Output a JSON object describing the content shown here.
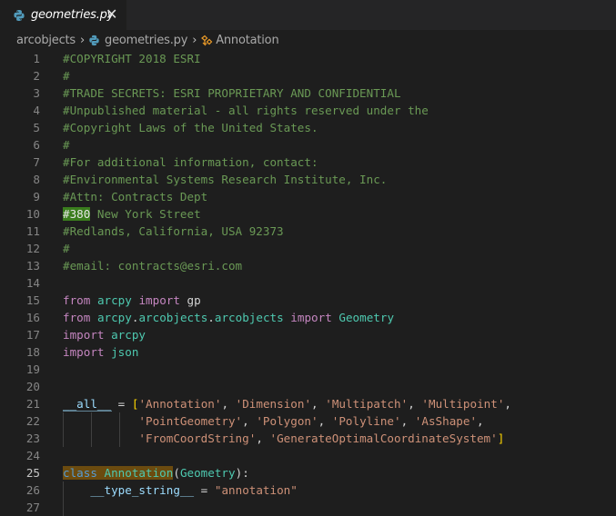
{
  "tab": {
    "filename": "geometries.py",
    "close_glyph": "✕"
  },
  "breadcrumb": {
    "folder": "arcobjects",
    "file": "geometries.py",
    "symbol": "Annotation",
    "separator": "›"
  },
  "colors": {
    "comment": "#6a9955",
    "keyword_import": "#c586c0",
    "keyword_class": "#569cd6",
    "module": "#4ec9b0",
    "identifier": "#9cdcfe",
    "string": "#ce9178",
    "default": "#d4d4d4",
    "class_name": "#4ec9b0",
    "bracket": "#ffd700"
  },
  "editor": {
    "active_line": 25,
    "lines": [
      {
        "n": "1",
        "code": "#COPYRIGHT 2018 ESRI"
      },
      {
        "n": "2",
        "code": "#"
      },
      {
        "n": "3",
        "code": "#TRADE SECRETS: ESRI PROPRIETARY AND CONFIDENTIAL"
      },
      {
        "n": "4",
        "code": "#Unpublished material - all rights reserved under the"
      },
      {
        "n": "5",
        "code": "#Copyright Laws of the United States."
      },
      {
        "n": "6",
        "code": "#"
      },
      {
        "n": "7",
        "code": "#For additional information, contact:"
      },
      {
        "n": "8",
        "code": "#Environmental Systems Research Institute, Inc."
      },
      {
        "n": "9",
        "code": "#Attn: Contracts Dept"
      },
      {
        "n": "10",
        "code": "#380 New York Street"
      },
      {
        "n": "11",
        "code": "#Redlands, California, USA 92373"
      },
      {
        "n": "12",
        "code": "#"
      },
      {
        "n": "13",
        "code": "#email: contracts@esri.com"
      },
      {
        "n": "14",
        "code": ""
      },
      {
        "n": "15",
        "code": "from arcpy import gp"
      },
      {
        "n": "16",
        "code": "from arcpy.arcobjects.arcobjects import Geometry"
      },
      {
        "n": "17",
        "code": "import arcpy"
      },
      {
        "n": "18",
        "code": "import json"
      },
      {
        "n": "19",
        "code": ""
      },
      {
        "n": "20",
        "code": ""
      },
      {
        "n": "21",
        "code": "__all__ = ['Annotation', 'Dimension', 'Multipatch', 'Multipoint',"
      },
      {
        "n": "22",
        "code": "           'PointGeometry', 'Polygon', 'Polyline', 'AsShape',"
      },
      {
        "n": "23",
        "code": "           'FromCoordString', 'GenerateOptimalCoordinateSystem']"
      },
      {
        "n": "24",
        "code": ""
      },
      {
        "n": "25",
        "code": "class Annotation(Geometry):"
      },
      {
        "n": "26",
        "code": "    __type_string__ = \"annotation\""
      },
      {
        "n": "27",
        "code": ""
      }
    ]
  }
}
